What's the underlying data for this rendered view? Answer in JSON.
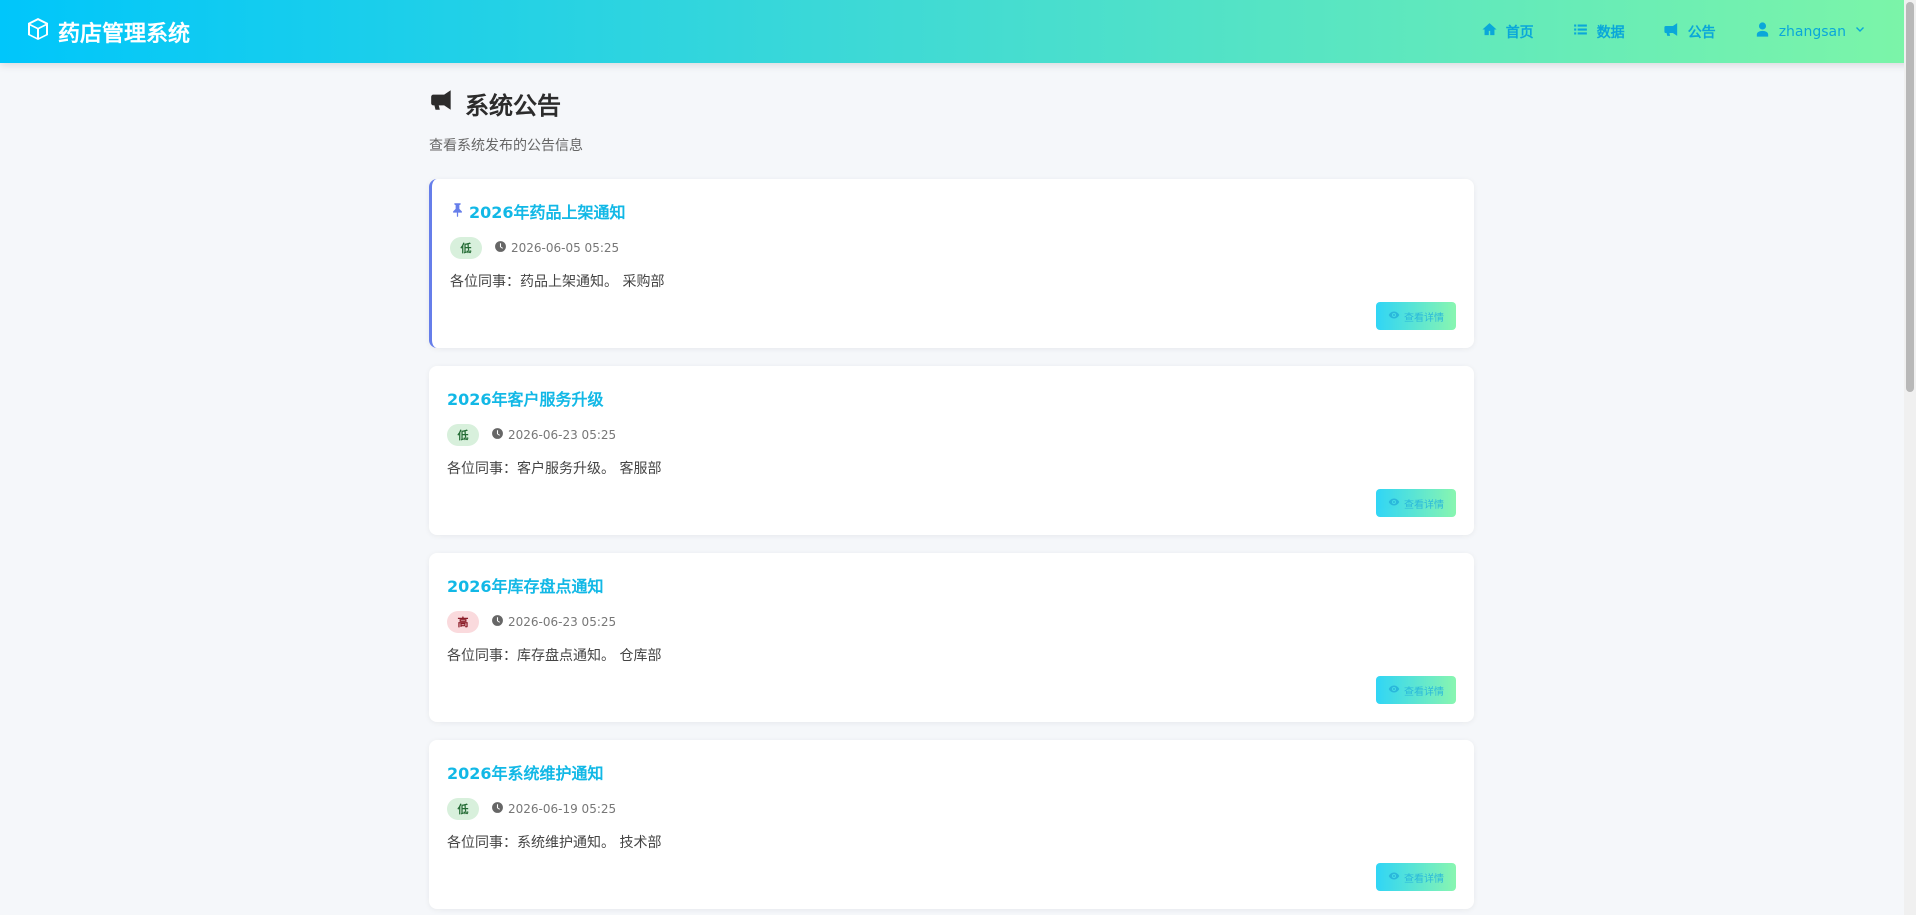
{
  "header": {
    "brand": "药店管理系统",
    "nav": {
      "home": "首页",
      "data": "数据",
      "notice": "公告",
      "user": "zhangsan"
    }
  },
  "page": {
    "title": "系统公告",
    "subtitle": "查看系统发布的公告信息"
  },
  "notices": [
    {
      "title": "2026年药品上架通知",
      "priority": "低",
      "date": "2026-06-05 05:25",
      "content": "各位同事：药品上架通知。 采购部",
      "button": "查看详情",
      "pinned": true
    },
    {
      "title": "2026年客户服务升级",
      "priority": "低",
      "date": "2026-06-23 05:25",
      "content": "各位同事：客户服务升级。 客服部",
      "button": "查看详情",
      "pinned": false
    },
    {
      "title": "2026年库存盘点通知",
      "priority": "高",
      "date": "2026-06-23 05:25",
      "content": "各位同事：库存盘点通知。 仓库部",
      "button": "查看详情",
      "pinned": false
    },
    {
      "title": "2026年系统维护通知",
      "priority": "低",
      "date": "2026-06-19 05:25",
      "content": "各位同事：系统维护通知。 技术部",
      "button": "查看详情",
      "pinned": false
    }
  ],
  "colors": {
    "header_gradient_start": "#00c6fb",
    "header_gradient_end": "#7cf5a8",
    "title_accent": "#12b8e6",
    "pin_accent": "#667eea",
    "badge_low_bg": "#d8f0dc",
    "badge_high_bg": "#fadadd"
  }
}
